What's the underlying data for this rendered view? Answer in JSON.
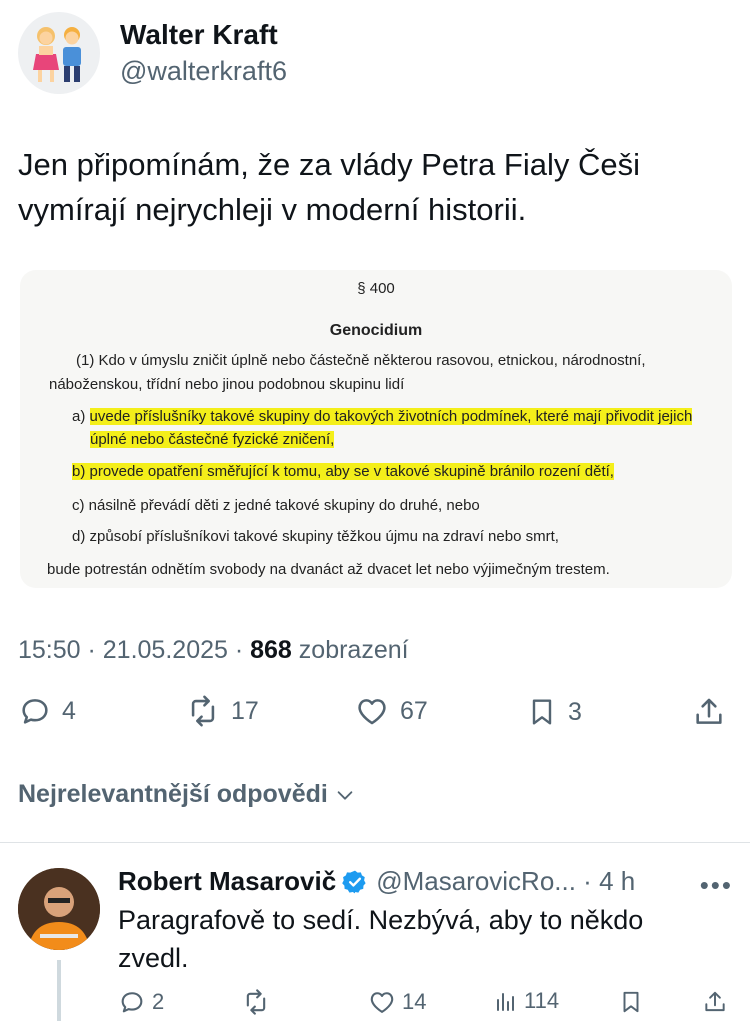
{
  "tweet": {
    "author_name": "Walter Kraft",
    "author_handle": "@walterkraft6",
    "text": "Jen připomínám, že za vlády Petra Fialy Češi vymírají nejrychleji v moderní historii.",
    "timestamp": "15:50 · 21.05.2025 · ",
    "views_count": "868",
    "views_label": " zobrazení",
    "replies": "4",
    "reposts": "17",
    "likes": "67",
    "bookmarks": "3"
  },
  "document": {
    "paragraph": "§ 400",
    "title": "Genocidium",
    "intro_1": "(1) Kdo v úmyslu zničit úplně nebo částečně některou rasovou, etnickou, národnostní,",
    "intro_2": "náboženskou, třídní nebo jinou podobnou skupinu lidí",
    "a_prefix": "a) ",
    "a_1": "uvede příslušníky takové skupiny do takových životních podmínek, které mají přivodit jejich",
    "a_2": "úplné nebo částečné fyzické zničení,",
    "b": "b) provede opatření směřující k tomu, aby se v takové skupině bránilo rození dětí,",
    "c": "c) násilně převádí děti z jedné takové skupiny do druhé, nebo",
    "d": "d) způsobí příslušníkovi takové skupiny těžkou újmu na zdraví nebo smrt,",
    "penalty": "bude potrestán odnětím svobody na dvanáct až dvacet let nebo výjimečným trestem."
  },
  "replies_section": {
    "sort_label": "Nejrelevantnější odpovědi"
  },
  "reply": {
    "author_name": "Robert Masarovič",
    "author_handle": "@MasarovicRo... · 4 h",
    "more": "•••",
    "text": "Paragrafově to sedí. Nezbývá, aby to někdo zvedl.",
    "replies": "2",
    "likes": "14",
    "views": "114"
  },
  "colors": {
    "highlight": "#f4ef1a",
    "verified": "#1d9bf0",
    "muted": "#536471"
  },
  "icons": [
    "couple-emoji-avatar",
    "reply-icon",
    "repost-icon",
    "like-icon",
    "bookmark-icon",
    "share-icon",
    "chevron-down-icon",
    "verified-badge-icon",
    "views-icon",
    "more-icon"
  ]
}
